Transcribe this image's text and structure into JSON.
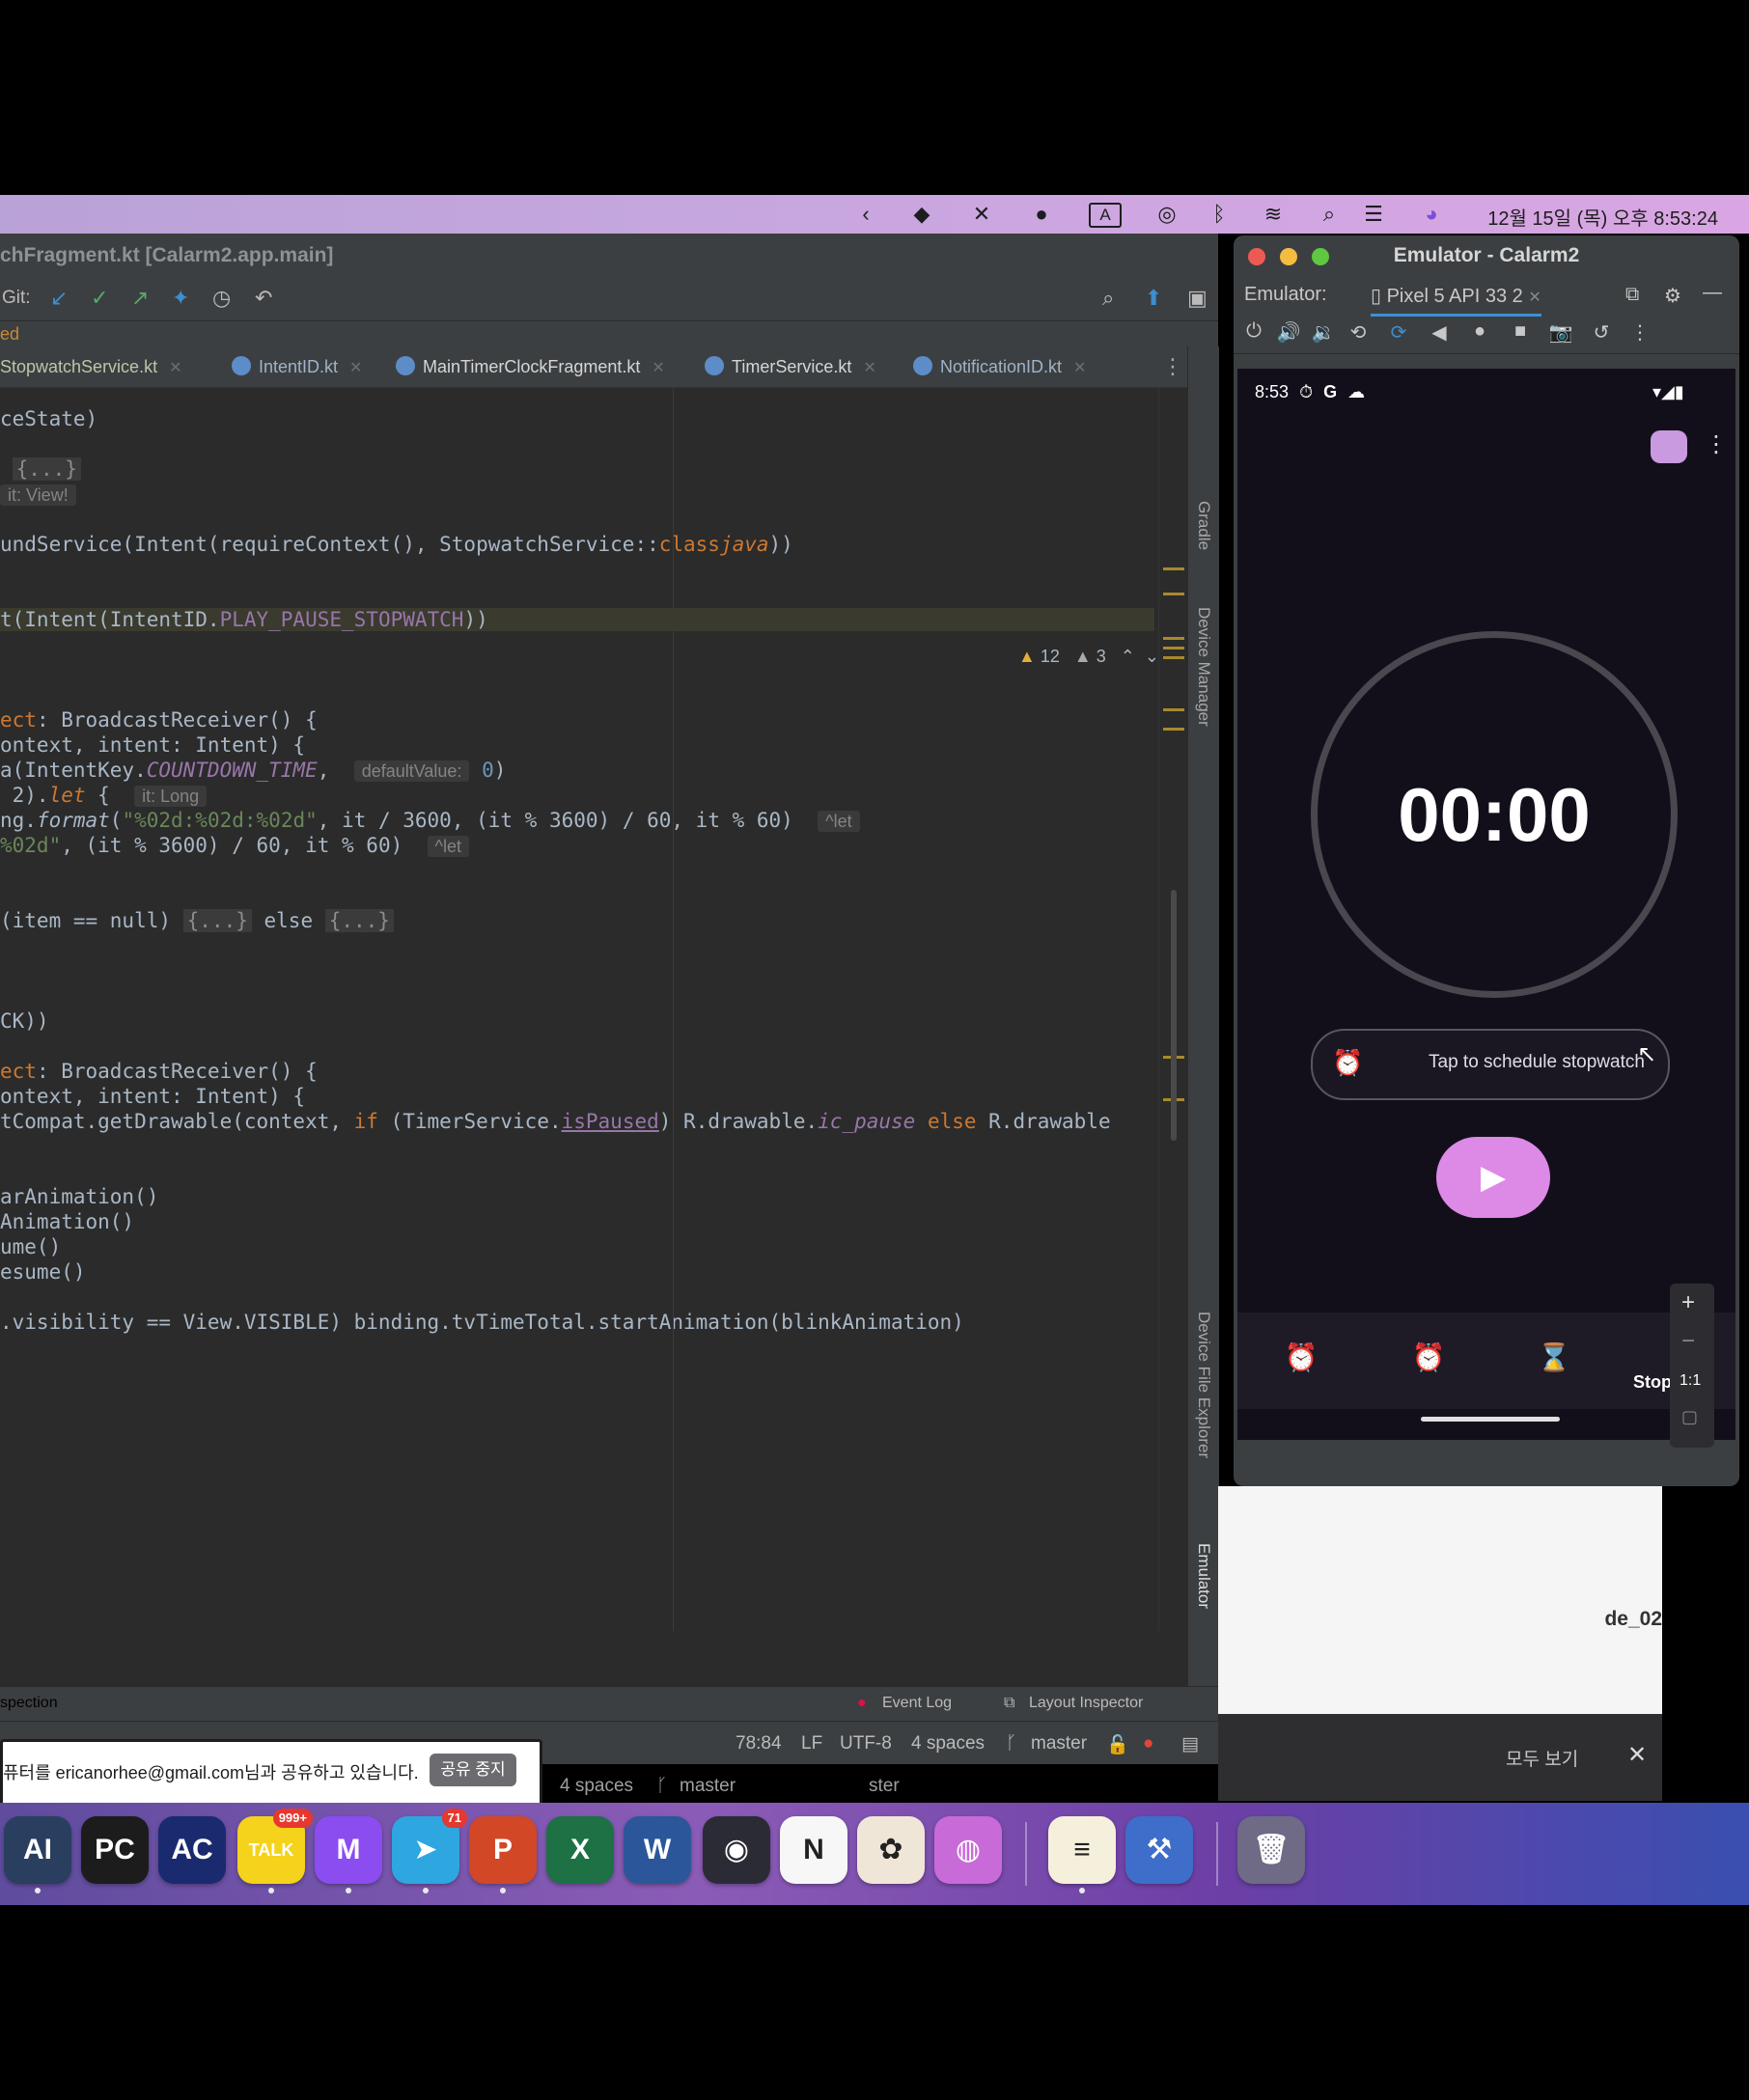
{
  "menubar": {
    "clock": "12월 15일 (목) 오후 8:53:24",
    "icons": [
      "chevron-left-icon",
      "shield-icon",
      "mute-icon",
      "chat-icon",
      "keyboard-a-icon",
      "airdrop-icon",
      "bluetooth-icon",
      "wifi-icon",
      "search-icon",
      "control-center-icon",
      "siri-icon"
    ]
  },
  "ide": {
    "title": "chFragment.kt [Calarm2.app.main]",
    "git_label": "Git:",
    "breadcrumb": "ed",
    "tabs": [
      "StopwatchService.kt",
      "IntentID.kt",
      "MainTimerClockFragment.kt",
      "TimerService.kt",
      "NotificationID.kt"
    ],
    "problems": {
      "warnings": "12",
      "weak_warnings": "3"
    },
    "code": [
      {
        "t": "ceState)"
      },
      {
        "fold": "{...}"
      },
      {
        "hint": "it: View!"
      },
      {
        "pre": "undService(Intent(requireContext(), StopwatchService::",
        "kw": "class",
        ".": ".",
        "it": "java",
        "post": "))"
      },
      {
        "pre": "t(Intent(IntentID.",
        "fld": "PLAY_PAUSE_STOPWATCH",
        "post": "))"
      },
      {
        "kw": "ect",
        "post": ": BroadcastReceiver() {"
      },
      {
        "pre": "ontext, intent: Intent) {"
      },
      {
        "pre": "a(IntentKey.",
        "fld": "COUNTDOWN_TIME",
        "post": ",",
        "hint": "defaultValue:",
        "num": "0",
        "end": ")"
      },
      {
        "pre": " 2).",
        "kw": "let",
        "post": " {",
        "hint": "it: Long"
      },
      {
        "pre": "ng.",
        "it": "format",
        "str": "\"%02d:%02d:%02d\"",
        "post": ", it / 3600, (it % 3600) / 60, it % 60)",
        "hint": "^let"
      },
      {
        "str": "%02d\"",
        "post": ", (it % 3600) / 60, it % 60)",
        "hint": "^let"
      },
      {
        "pre": "(item == null) ",
        "fold": "{...}",
        "mid": " else ",
        "fold2": "{...}"
      },
      {
        "pre": "CK))"
      },
      {
        "kw": "ect",
        "post": ": BroadcastReceiver() {"
      },
      {
        "pre": "ontext, intent: Intent) {"
      },
      {
        "pre": "tCompat.getDrawable(context, ",
        "kw": "if",
        "mid": " (TimerService.",
        "fld": "isPaused",
        "post": ") R.drawable.",
        "it": "ic_pause",
        "kw2": " else ",
        "end": "R.drawable"
      },
      {
        "pre": "arAnimation()"
      },
      {
        "pre": "Animation()"
      },
      {
        "pre": "ume()"
      },
      {
        "pre": "esume()"
      },
      {
        "pre": ".visibility == View.VISIBLE) binding.tvTimeTotal.startAnimation(blinkAnimation)"
      }
    ],
    "side_tabs": [
      "Gradle",
      "Device Manager",
      "Device File Explorer",
      "Emulator"
    ],
    "toolwin": {
      "left": "spection",
      "event_log": "Event Log",
      "layout_inspector": "Layout Inspector"
    },
    "status": {
      "position": "78:84",
      "line_sep": "LF",
      "encoding": "UTF-8",
      "indent": "4 spaces",
      "branch": "master"
    }
  },
  "emulator": {
    "title": "Emulator - Calarm2",
    "label": "Emulator:",
    "device_tab": "Pixel 5 API 33 2",
    "phone": {
      "time": "8:53",
      "timer": "00:00",
      "schedule_label": "Tap to schedule stopwatch",
      "nav_label": "Stop",
      "zoom_label": "1:1"
    }
  },
  "background_window": {
    "label": "de_02",
    "see_all": "모두 보기"
  },
  "share_banner": {
    "text": "퓨터를 ericanorhee@gmail.com님과 공유하고 있습니다.",
    "stop_label": "공유 중지"
  },
  "behind_status": {
    "indent": "4 spaces",
    "branch": "master",
    "branch2": "ster"
  },
  "dock": {
    "apps": [
      {
        "name": "ai-app",
        "label": "AI",
        "color": "#2a3f5f"
      },
      {
        "name": "pycharm-app",
        "label": "PC",
        "color": "#1c1c1c"
      },
      {
        "name": "appcode-app",
        "label": "AC",
        "color": "#1a2a6e"
      },
      {
        "name": "kakaotalk-app",
        "label": "TALK",
        "color": "#f5d21b",
        "badge": "999+"
      },
      {
        "name": "messenger-app",
        "label": "M",
        "color": "#8b4cf0"
      },
      {
        "name": "telegram-app",
        "label": "➤",
        "color": "#2ea6e0",
        "badge": "71"
      },
      {
        "name": "powerpoint-app",
        "label": "P",
        "color": "#d24726"
      },
      {
        "name": "excel-app",
        "label": "X",
        "color": "#1e7145"
      },
      {
        "name": "word-app",
        "label": "W",
        "color": "#2b579a"
      },
      {
        "name": "obs-app",
        "label": "◉",
        "color": "#2b2b35"
      },
      {
        "name": "notion-app",
        "label": "N",
        "color": "#f7f7f7"
      },
      {
        "name": "photos-app",
        "label": "✿",
        "color": "#f0e6d8"
      },
      {
        "name": "siri-app",
        "label": "◍",
        "color": "#c86ad8"
      },
      {
        "name": "notes-app",
        "label": "≡",
        "color": "#f5f0dc"
      },
      {
        "name": "xcode-app",
        "label": "⚒",
        "color": "#3e6ec9"
      },
      {
        "name": "trash-app",
        "label": "🗑",
        "color": "#6f6a86"
      }
    ]
  }
}
